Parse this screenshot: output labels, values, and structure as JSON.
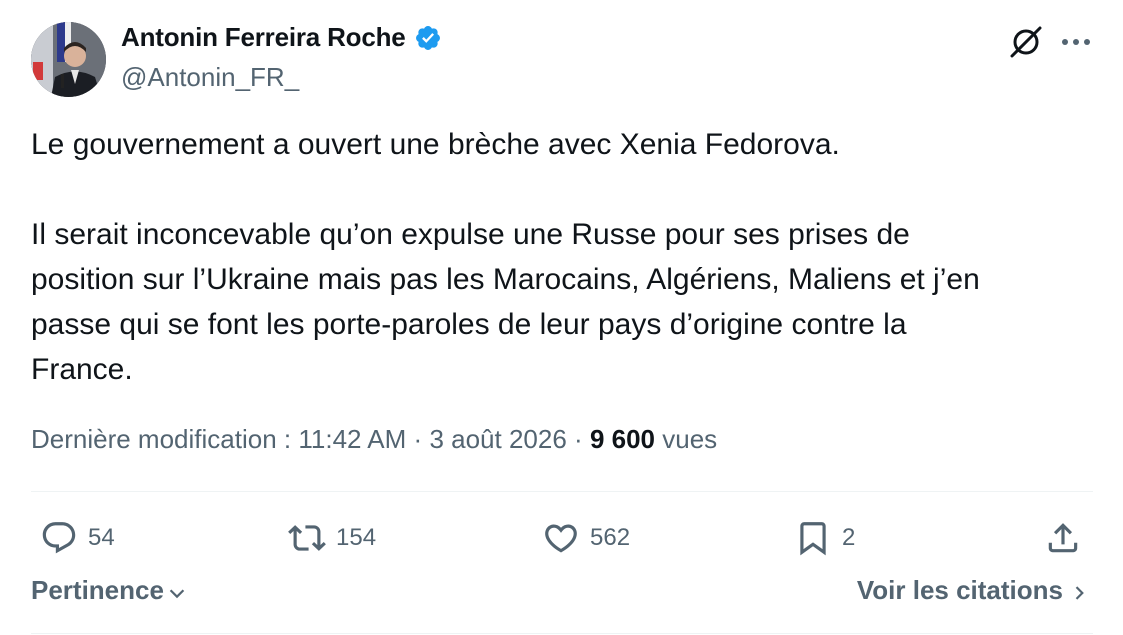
{
  "author": {
    "display_name": "Antonin Ferreira Roche",
    "handle": "@Antonin_FR_",
    "verified_color": "#1d9bf0"
  },
  "tweet": {
    "paragraph_1": "Le gouvernement a ouvert une brèche avec Xenia Fedorova.",
    "paragraph_2_lines": [
      "Il serait inconcevable qu’on expulse une Russe pour ses prises de",
      "position sur l’Ukraine mais pas les Marocains, Algériens, Maliens et j’en",
      "passe qui se font les porte-paroles de leur pays d’origine contre la",
      "France."
    ]
  },
  "meta": {
    "edited_label": "Dernière modification :",
    "time": "11:42 AM",
    "separator_1": "·",
    "date": "3 août 2026",
    "separator_2": "·",
    "views_count": "9 600",
    "views_label": "vues"
  },
  "actions": {
    "replies": "54",
    "reposts": "154",
    "likes": "562",
    "bookmarks": "2"
  },
  "footer": {
    "sort_label": "Pertinence",
    "quotes_label": "Voir les citations"
  },
  "icons": {
    "grok": "grok-icon",
    "more": "more-icon",
    "reply": "reply-icon",
    "repost": "repost-icon",
    "like": "heart-icon",
    "bookmark": "bookmark-icon",
    "share": "share-icon"
  },
  "colors": {
    "text": "#0f1419",
    "secondary": "#536471",
    "divider": "#eff3f4"
  }
}
